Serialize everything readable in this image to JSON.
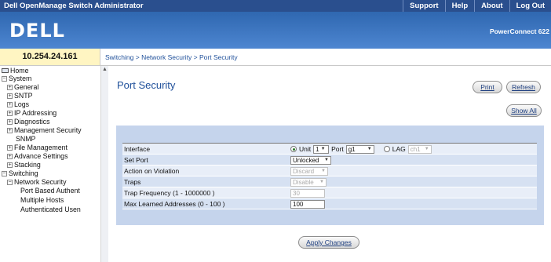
{
  "app_title": "Dell OpenManage Switch Administrator",
  "top_links": [
    "Support",
    "Help",
    "About",
    "Log Out"
  ],
  "logo": "DELL",
  "product": "PowerConnect 622",
  "ip_address": "10.254.24.161",
  "breadcrumb": "Switching > Network Security > Port Security",
  "nav": {
    "home": "Home",
    "system": "System",
    "general": "General",
    "sntp": "SNTP",
    "logs": "Logs",
    "ip_addressing": "IP Addressing",
    "diagnostics": "Diagnostics",
    "management_security": "Management Security",
    "snmp": "SNMP",
    "file_management": "File Management",
    "advance_settings": "Advance Settings",
    "stacking": "Stacking",
    "switching": "Switching",
    "network_security": "Network Security",
    "port_based_authent": "Port Based Authent",
    "multiple_hosts": "Multiple Hosts",
    "authenticated_users": "Authenticated Usen"
  },
  "page_title": "Port Security",
  "buttons": {
    "print": "Print",
    "refresh": "Refresh",
    "show_all": "Show All",
    "apply_changes": "Apply Changes"
  },
  "form": {
    "interface_label": "Interface",
    "unit_label": "Unit",
    "unit_value": "1",
    "port_label": "Port",
    "port_value": "g1",
    "lag_label": "LAG",
    "lag_value": "ch1",
    "set_port_label": "Set Port",
    "set_port_value": "Unlocked",
    "action_label": "Action on Violation",
    "action_value": "Discard",
    "traps_label": "Traps",
    "traps_value": "Disable",
    "trap_freq_label": "Trap Frequency (1 - 1000000 )",
    "trap_freq_value": "30",
    "max_learned_label": "Max Learned Addresses (0 - 100 )",
    "max_learned_value": "100"
  }
}
